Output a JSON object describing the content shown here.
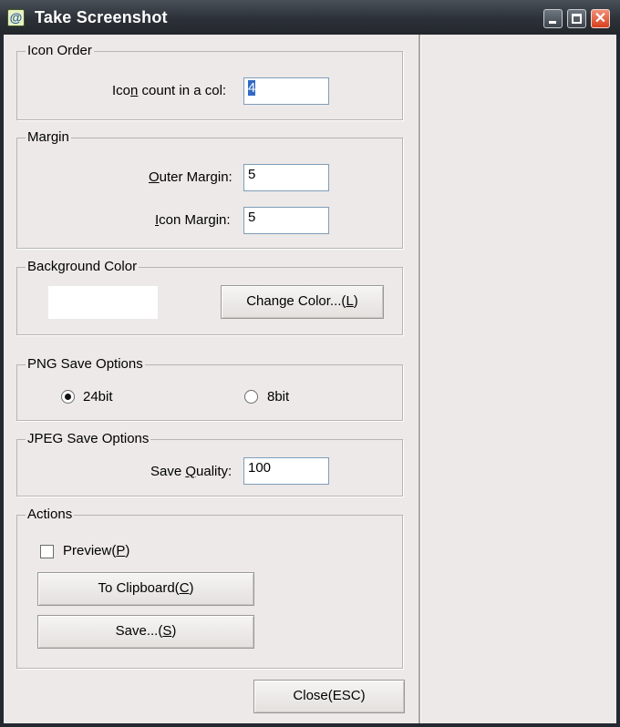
{
  "window": {
    "title": "Take Screenshot",
    "app_icon_glyph": "@",
    "controls": {
      "minimize": "minimize-icon",
      "maximize": "maximize-icon",
      "close": "close-icon",
      "close_glyph": "✕"
    }
  },
  "icon_order": {
    "title": "Icon Order",
    "count_label_before": "Ico",
    "count_label_ul": "n",
    "count_label_after": " count in a col:",
    "count_value": "4"
  },
  "margin": {
    "title": "Margin",
    "outer_label_ul": "O",
    "outer_label_rest": "uter Margin:",
    "outer_value": "5",
    "icon_label_ul": "I",
    "icon_label_rest": "con Margin:",
    "icon_value": "5"
  },
  "background_color": {
    "title": "Background Color",
    "swatch_color": "#ffffff",
    "change_before": "Change Color...(",
    "change_ul": "L",
    "change_after": ")"
  },
  "png": {
    "title": "PNG Save Options",
    "option_24": "24bit",
    "option_8": "8bit",
    "selected": "24bit"
  },
  "jpeg": {
    "title": "JPEG Save Options",
    "quality_before": "Save ",
    "quality_ul": "Q",
    "quality_after": "uality:",
    "quality_value": "100"
  },
  "actions": {
    "title": "Actions",
    "preview_before": "Preview(",
    "preview_ul": "P",
    "preview_after": ")",
    "preview_checked": false,
    "clipboard_before": "To Clipboard(",
    "clipboard_ul": "C",
    "clipboard_after": ")",
    "save_before": "Save...(",
    "save_ul": "S",
    "save_after": ")"
  },
  "close_button": "Close(ESC)"
}
